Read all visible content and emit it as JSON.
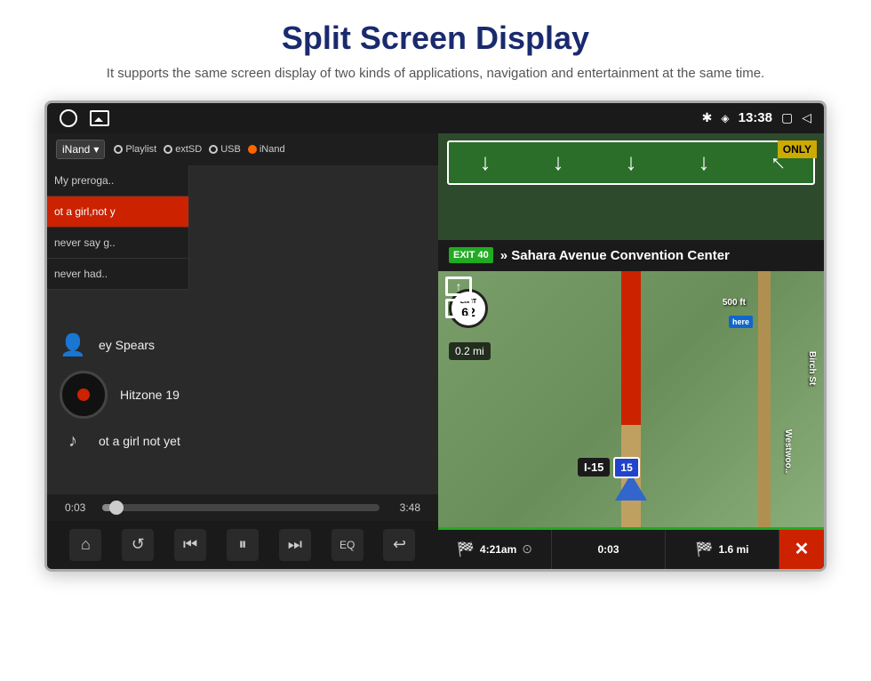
{
  "page": {
    "title": "Split Screen Display",
    "subtitle": "It supports the same screen display of two kinds of applications,\nnavigation and entertainment at the same time."
  },
  "statusBar": {
    "time": "13:38",
    "bluetooth_icon": "✱",
    "location_icon": "♦",
    "window_icon": "▢",
    "back_icon": "◁"
  },
  "musicPlayer": {
    "source_label": "iNand",
    "source_dropdown_arrow": "▾",
    "sources": [
      {
        "label": "Playlist",
        "active": false
      },
      {
        "label": "extSD",
        "active": false
      },
      {
        "label": "USB",
        "active": false
      },
      {
        "label": "iNand",
        "active": true
      }
    ],
    "playlist": [
      {
        "title": "My preroga..",
        "active": false
      },
      {
        "title": "ot a girl,not y",
        "active": true
      },
      {
        "title": "never say g..",
        "active": false
      },
      {
        "title": "never had..",
        "active": false
      }
    ],
    "artist": "ey Spears",
    "album": "Hitzone 19",
    "song": "ot a girl not yet",
    "time_current": "0:03",
    "time_total": "3:48",
    "progress_percent": 1.4,
    "controls": {
      "home": "⌂",
      "repeat": "↺",
      "prev": "⏮",
      "pause": "⏸",
      "next": "⏭",
      "eq": "EQ",
      "back": "↩"
    }
  },
  "navigation": {
    "highway": "I-15",
    "exit_number": "EXIT 40",
    "exit_text": "» Sahara Avenue\nConvention Center",
    "speed_limit": "62",
    "distance_junction": "500 ft",
    "distance_remain": "0.2 mi",
    "only_label": "ONLY",
    "road_labels": {
      "birch": "Birch St",
      "westwood": "Westwoo.."
    },
    "bottom": {
      "eta": "4:21am",
      "elapsed": "0:03",
      "remaining": "1.6 mi"
    },
    "close_btn": "✕",
    "here_logo": "here"
  }
}
